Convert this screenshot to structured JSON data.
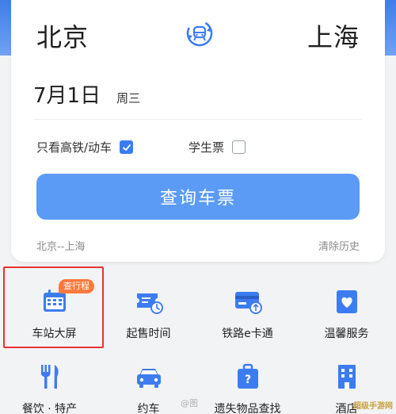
{
  "route": {
    "from_city": "北京",
    "to_city": "上海"
  },
  "date": {
    "main": "7月1日",
    "weekday": "周三"
  },
  "options": {
    "high_speed_label": "只看高铁/动车",
    "high_speed_checked": true,
    "student_label": "学生票",
    "student_checked": false
  },
  "query_button": "查询车票",
  "history": {
    "last_route": "北京--上海",
    "clear_label": "清除历史"
  },
  "services": [
    {
      "label": "车站大屏",
      "icon": "station-screen-icon",
      "badge": "查行程"
    },
    {
      "label": "起售时间",
      "icon": "ticket-clock-icon"
    },
    {
      "label": "铁路e卡通",
      "icon": "e-card-icon"
    },
    {
      "label": "温馨服务",
      "icon": "heart-box-icon"
    },
    {
      "label": "餐饮 · 特产",
      "icon": "fork-knife-icon"
    },
    {
      "label": "约车",
      "icon": "car-icon"
    },
    {
      "label": "遗失物品查找",
      "icon": "lost-bag-icon"
    },
    {
      "label": "酒店",
      "icon": "hotel-icon"
    }
  ],
  "watermark": "@图",
  "corner_logo": "超级手游网",
  "colors": {
    "accent": "#3b7cf5",
    "button": "#5b9bf6",
    "icon_blue": "#3d7cf0",
    "badge": "#ff7a3d",
    "highlight": "#e8322e"
  }
}
